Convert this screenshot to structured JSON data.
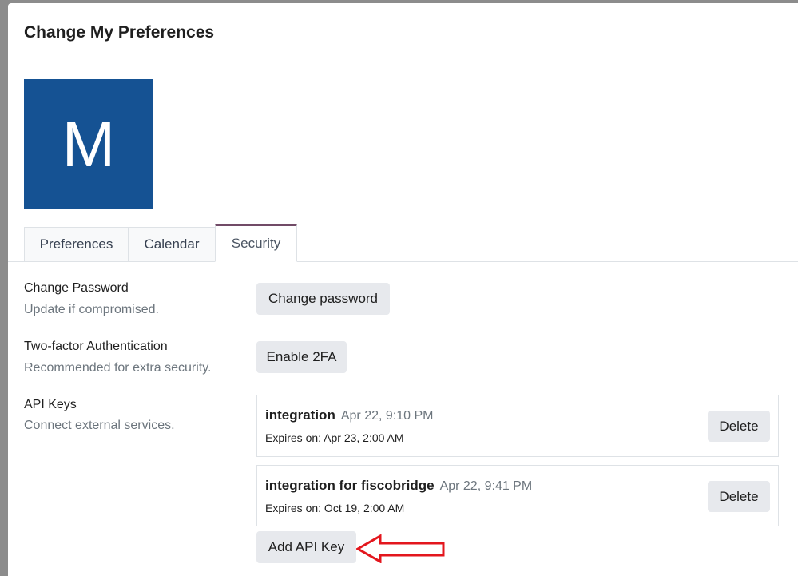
{
  "dialog": {
    "title": "Change My Preferences"
  },
  "avatar": {
    "initial": "M",
    "color": "#155293"
  },
  "tabs": [
    {
      "label": "Preferences",
      "active": false
    },
    {
      "label": "Calendar",
      "active": false
    },
    {
      "label": "Security",
      "active": true
    }
  ],
  "security": {
    "password": {
      "title": "Change Password",
      "description": "Update if compromised.",
      "button_label": "Change password"
    },
    "two_factor": {
      "title": "Two-factor Authentication",
      "description": "Recommended for extra security.",
      "button_label": "Enable 2FA"
    },
    "api_keys": {
      "title": "API Keys",
      "description": "Connect external services.",
      "keys": [
        {
          "name": "integration",
          "created": "Apr 22, 9:10 PM",
          "expiry": "Expires on: Apr 23, 2:00 AM",
          "delete_label": "Delete"
        },
        {
          "name": "integration for fiscobridge",
          "created": "Apr 22, 9:41 PM",
          "expiry": "Expires on: Oct 19, 2:00 AM",
          "delete_label": "Delete"
        }
      ],
      "add_label": "Add API Key"
    }
  },
  "annotation": {
    "arrow_color": "#e3161d"
  }
}
